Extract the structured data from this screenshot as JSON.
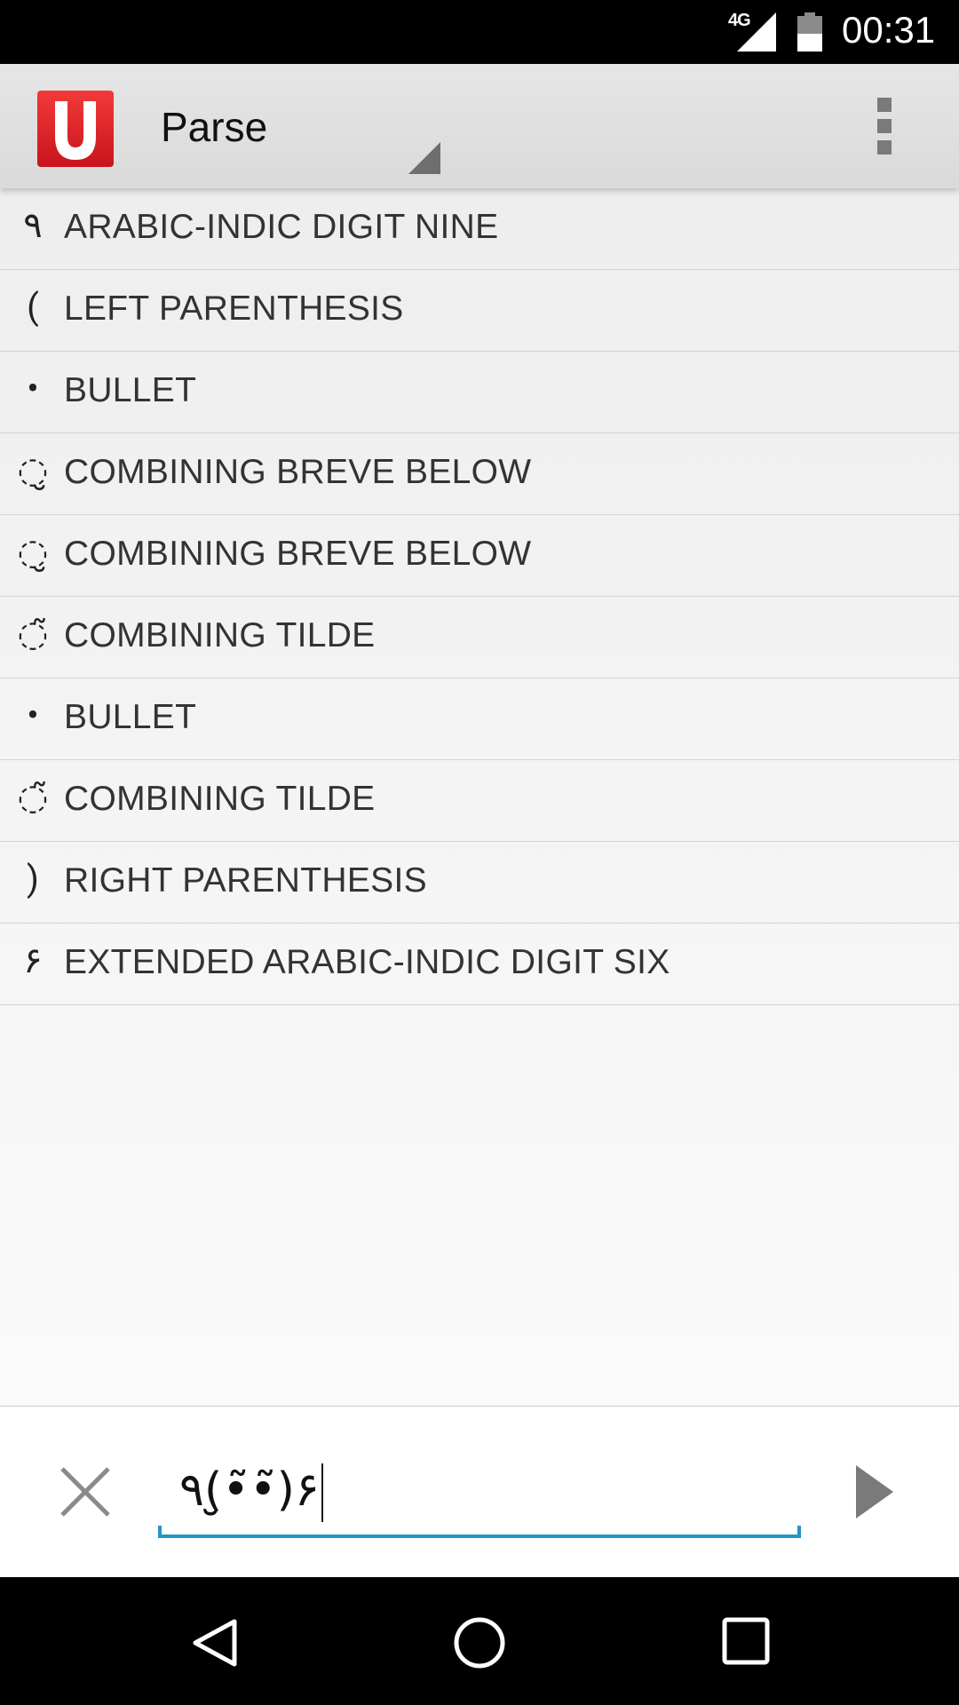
{
  "status_bar": {
    "network": "4G",
    "time": "00:31"
  },
  "action_bar": {
    "app_icon_letter": "U",
    "spinner_label": "Parse",
    "icons": {
      "spinner": "dropdown-arrow-icon",
      "overflow": "overflow-menu-icon"
    }
  },
  "characters": [
    {
      "glyph": "٩",
      "name": "ARABIC-INDIC DIGIT NINE"
    },
    {
      "glyph": "(",
      "name": "LEFT PARENTHESIS"
    },
    {
      "glyph": "•",
      "name": "BULLET"
    },
    {
      "glyph": "◌̮",
      "name": "COMBINING BREVE BELOW"
    },
    {
      "glyph": "◌̮",
      "name": "COMBINING BREVE BELOW"
    },
    {
      "glyph": "◌̃",
      "name": "COMBINING TILDE"
    },
    {
      "glyph": "•",
      "name": "BULLET"
    },
    {
      "glyph": "◌̃",
      "name": "COMBINING TILDE"
    },
    {
      "glyph": ")",
      "name": "RIGHT PARENTHESIS"
    },
    {
      "glyph": "۶",
      "name": "EXTENDED ARABIC-INDIC DIGIT SIX"
    }
  ],
  "input": {
    "value": "٩(̮̮•̃•̃)۶",
    "icons": {
      "clear": "close-icon",
      "submit": "play-arrow-icon"
    }
  },
  "nav_bar": {
    "icons": [
      "back-icon",
      "home-icon",
      "recents-icon"
    ]
  },
  "colors": {
    "accent": "#2196c9",
    "app_icon_red": "#e5202a",
    "status_bar": "#000000",
    "action_bar": "#e0e0e0"
  }
}
